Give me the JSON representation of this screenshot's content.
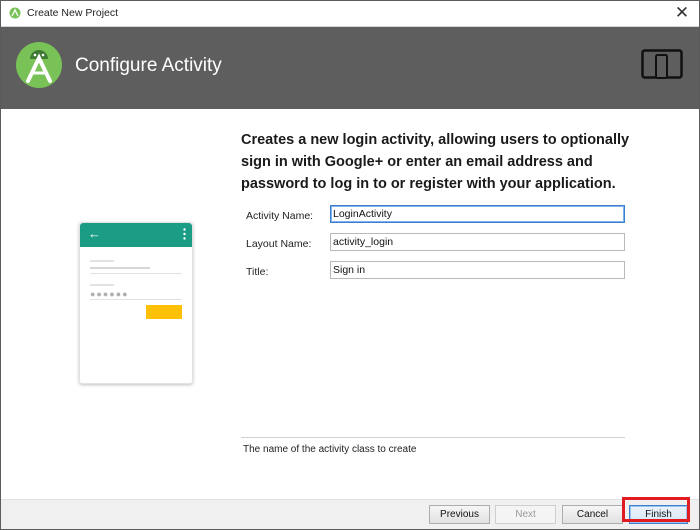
{
  "window": {
    "title": "Create New Project",
    "close_glyph": "✕"
  },
  "header": {
    "heading": "Configure Activity",
    "logo_icon": "android-studio-icon",
    "device_icon": "tablet-phone-icon"
  },
  "preview": {
    "back_glyph": "←",
    "password_dots": "●●●●●●",
    "accent_color": "#1b9c85",
    "button_color": "#ffc107"
  },
  "description": "Creates a new login activity, allowing users to optionally sign in with Google+ or enter an email address and password to log in to or register with your application.",
  "fields": {
    "activity_name": {
      "label": "Activity Name:",
      "value": "LoginActivity"
    },
    "layout_name": {
      "label": "Layout Name:",
      "value": "activity_login"
    },
    "title": {
      "label": "Title:",
      "value": "Sign in"
    }
  },
  "hint": "The name of the activity class to create",
  "buttons": {
    "previous": "Previous",
    "next": "Next",
    "cancel": "Cancel",
    "finish": "Finish"
  },
  "highlight_color": "#e21a22"
}
